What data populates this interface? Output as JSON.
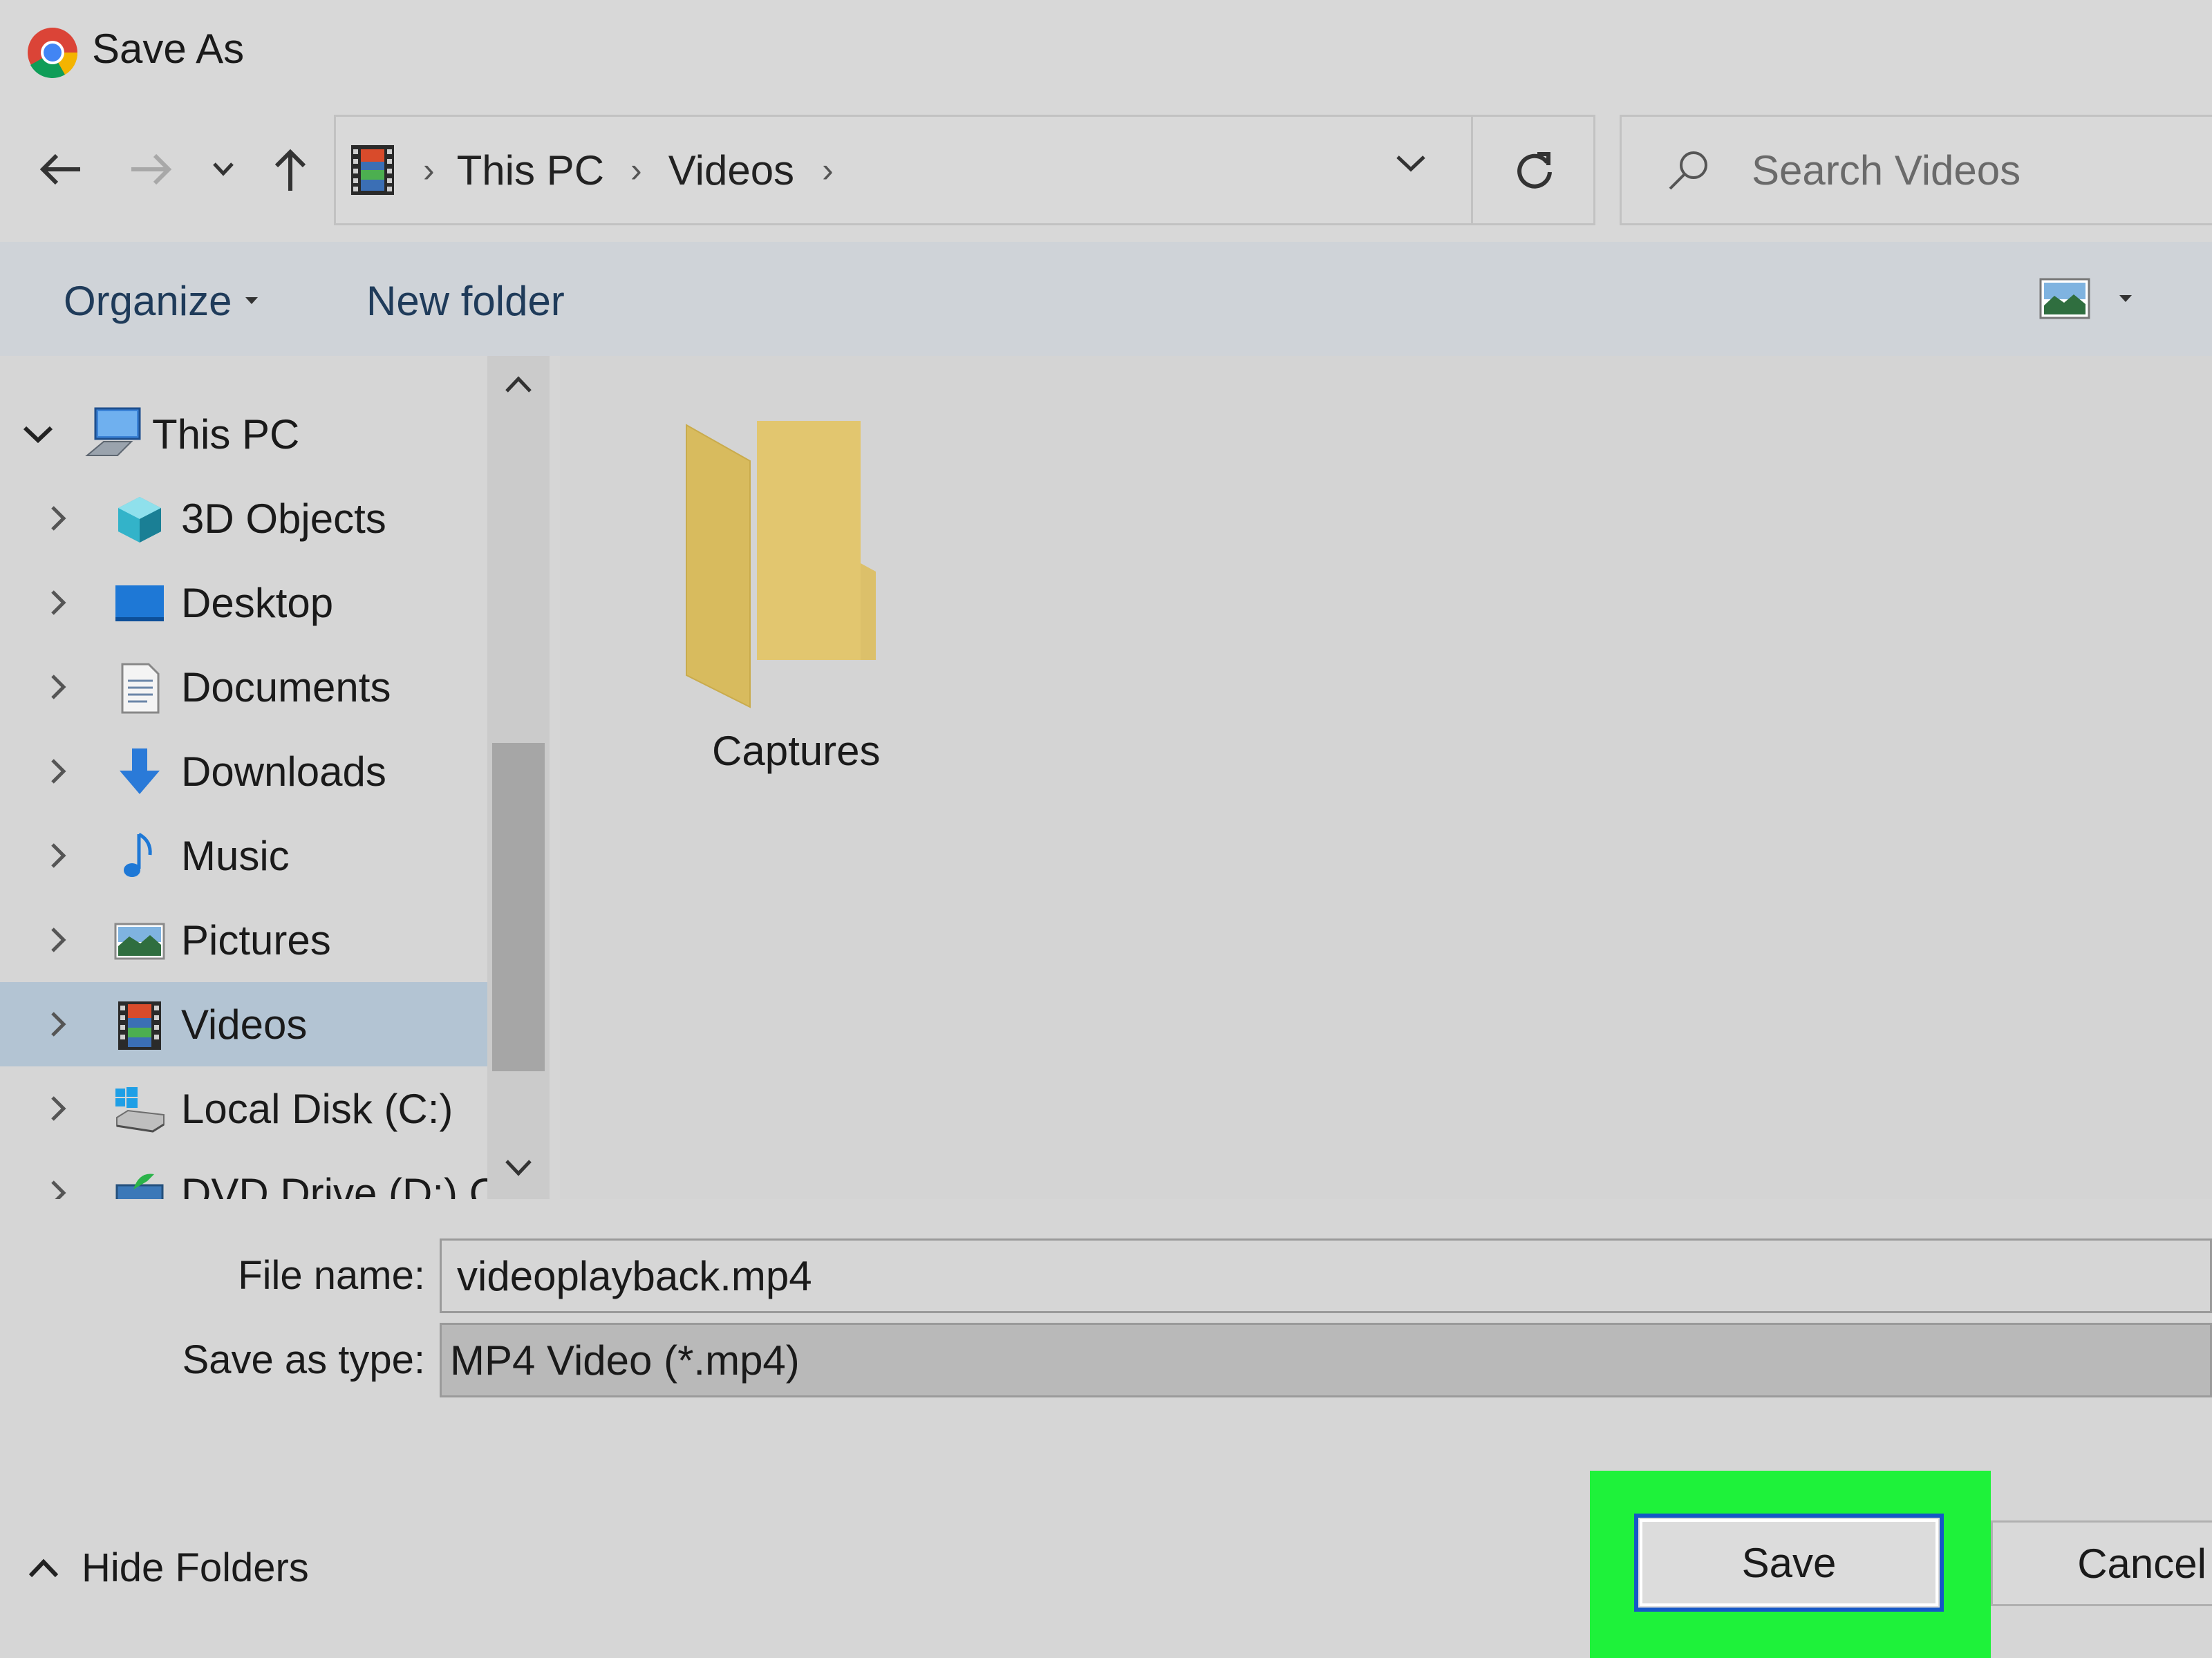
{
  "window": {
    "title": "Save As"
  },
  "address": {
    "crumbs": [
      "This PC",
      "Videos"
    ],
    "search_placeholder": "Search Videos"
  },
  "toolbar": {
    "organize_label": "Organize",
    "new_folder_label": "New folder"
  },
  "nav": {
    "root_label": "This PC",
    "items": [
      {
        "label": "3D Objects",
        "icon": "3d-objects-icon"
      },
      {
        "label": "Desktop",
        "icon": "desktop-icon"
      },
      {
        "label": "Documents",
        "icon": "documents-icon"
      },
      {
        "label": "Downloads",
        "icon": "downloads-icon"
      },
      {
        "label": "Music",
        "icon": "music-icon"
      },
      {
        "label": "Pictures",
        "icon": "pictures-icon"
      },
      {
        "label": "Videos",
        "icon": "videos-icon",
        "selected": true
      },
      {
        "label": "Local Disk (C:)",
        "icon": "local-disk-icon"
      },
      {
        "label": "DVD Drive (D:) C",
        "icon": "dvd-drive-icon"
      }
    ]
  },
  "content": {
    "folders": [
      {
        "label": "Captures"
      }
    ]
  },
  "form": {
    "file_name_label": "File name:",
    "file_name_value": "videoplayback.mp4",
    "save_type_label": "Save as type:",
    "save_type_value": "MP4 Video (*.mp4)"
  },
  "footer": {
    "hide_folders_label": "Hide Folders",
    "save_label": "Save",
    "cancel_label": "Cancel"
  },
  "colors": {
    "highlight": "#1ef23a",
    "selection": "#b3c4d3",
    "button_focus_border": "#1557c6"
  }
}
